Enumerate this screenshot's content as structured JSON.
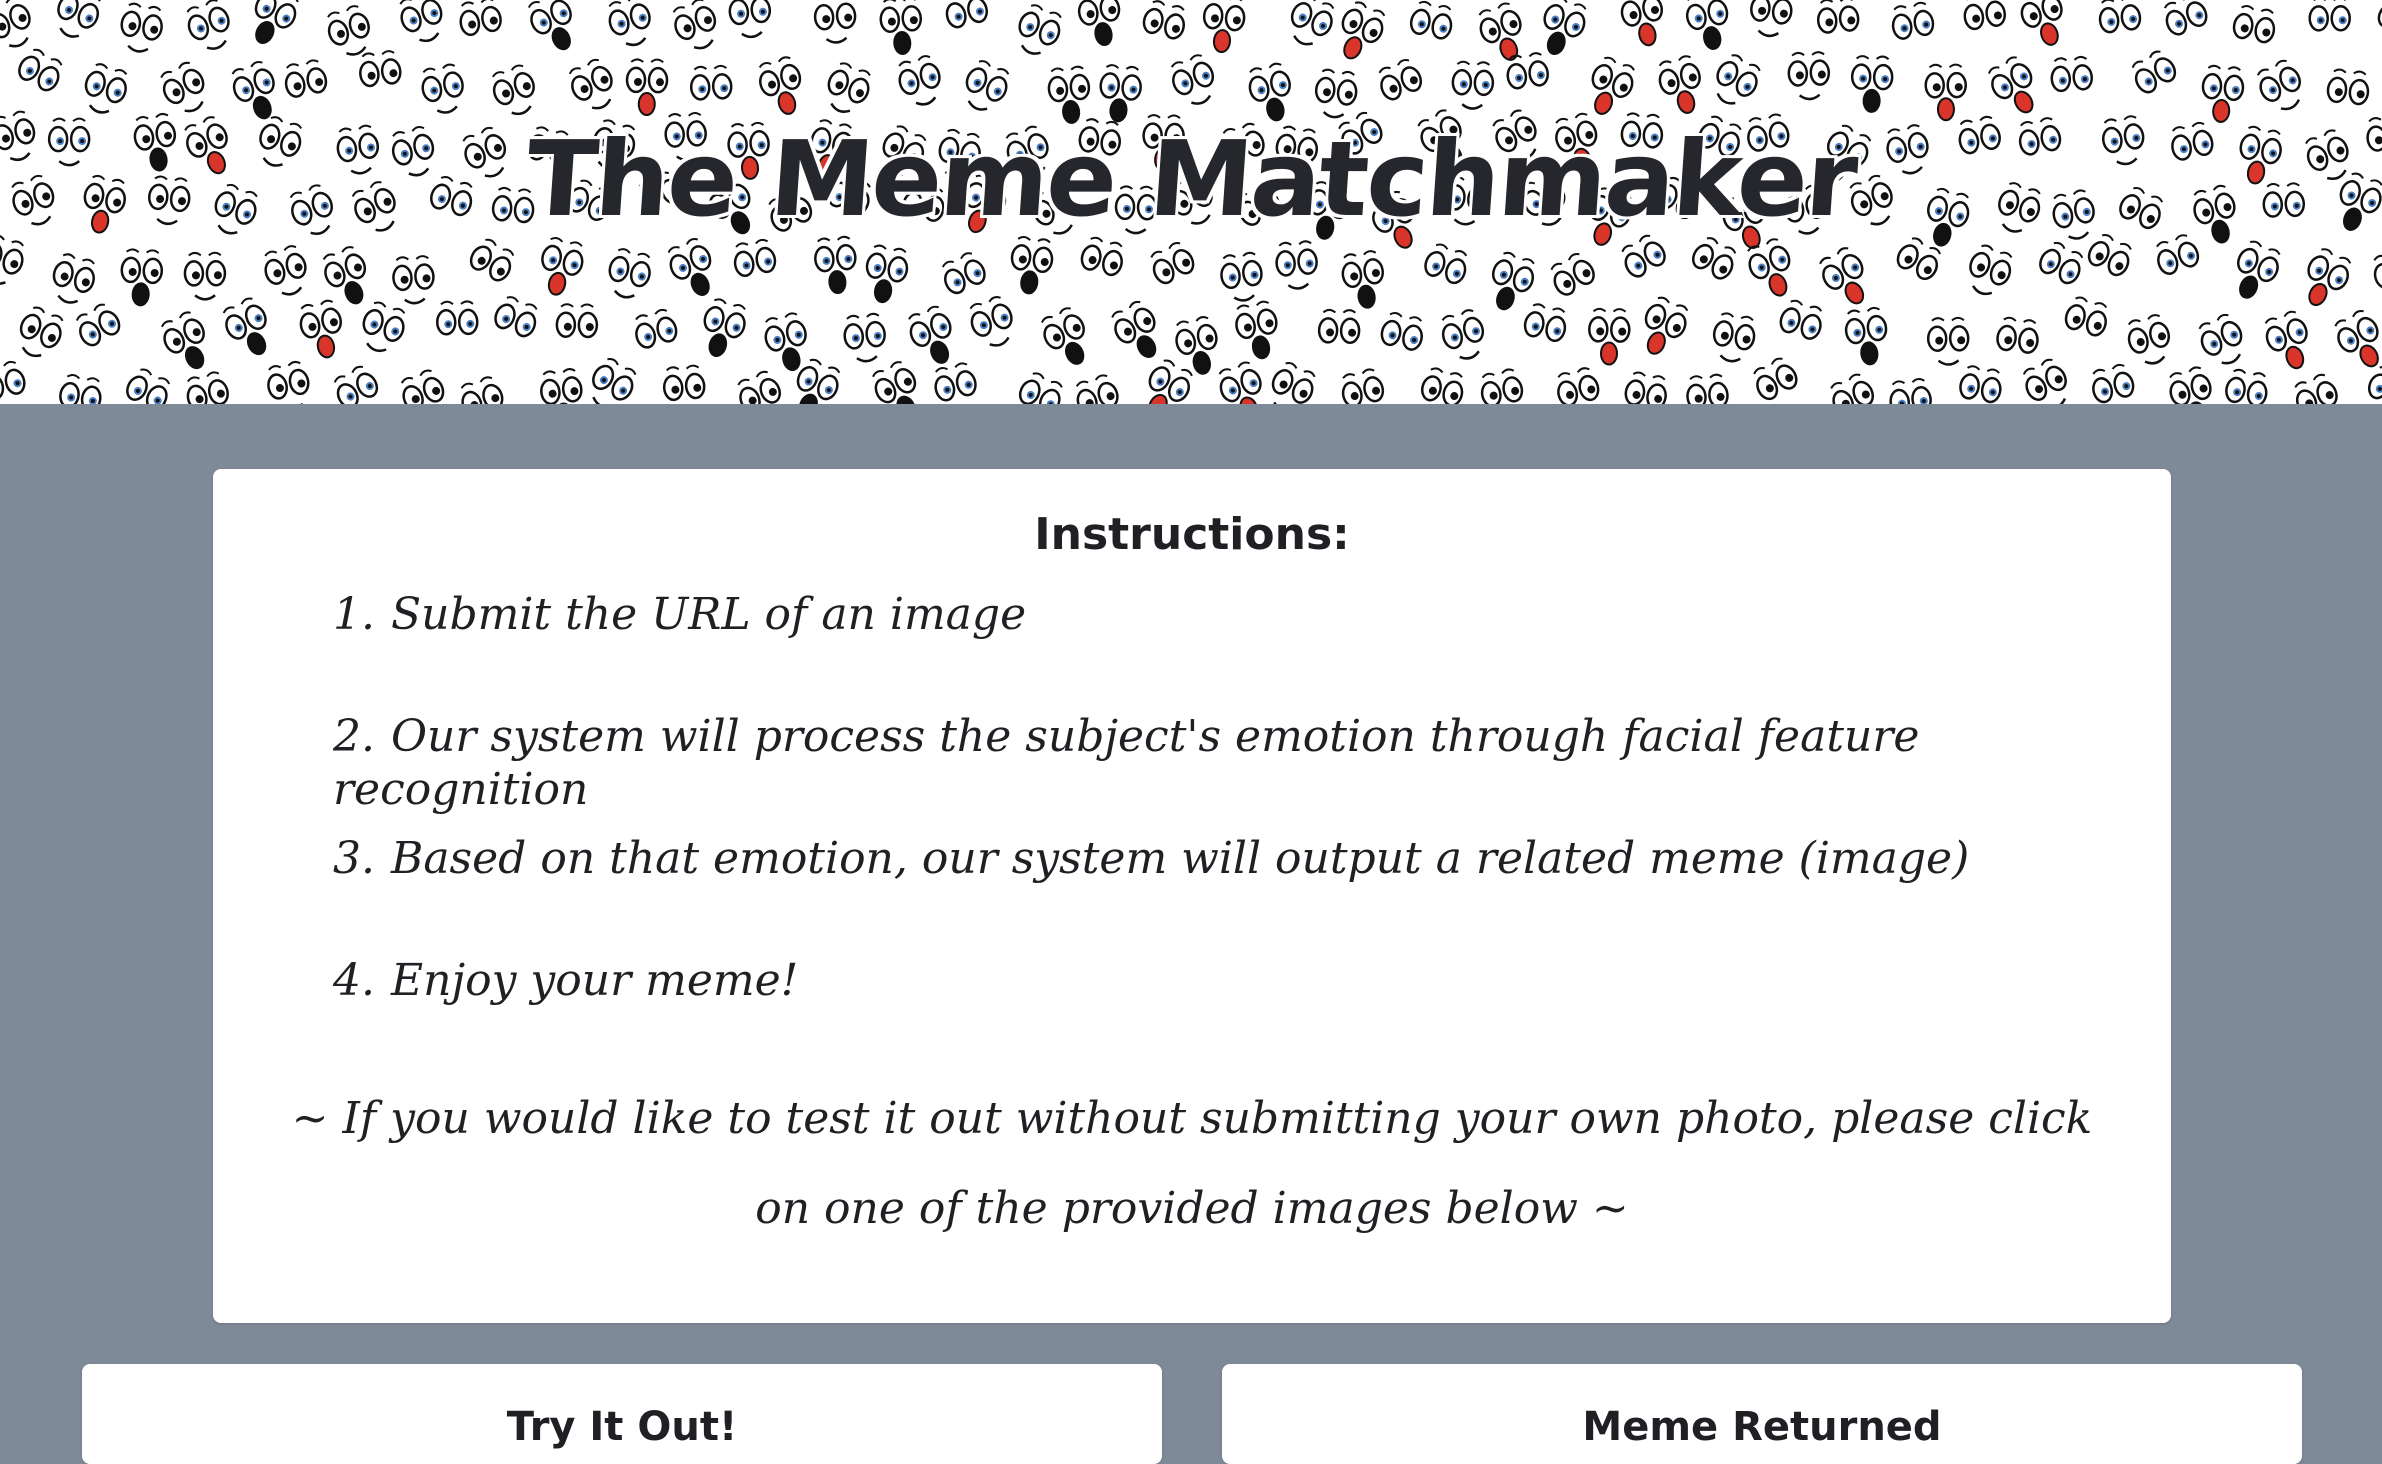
{
  "header": {
    "title": "The Meme Matchmaker"
  },
  "instructions": {
    "heading": "Instructions:",
    "steps": [
      {
        "num": "1.",
        "text": "Submit the URL of an image"
      },
      {
        "num": "2.",
        "text": "Our system will process the subject's emotion through facial feature recognition"
      },
      {
        "num": "3.",
        "text": "Based on that emotion, our system will output a related meme (image)"
      },
      {
        "num": "4.",
        "text": "Enjoy your meme!"
      }
    ],
    "note": "~ If you would like to test it out without submitting your own photo, please click on one of the provided images below ~"
  },
  "panels": {
    "try_title": "Try It Out!",
    "meme_title": "Meme Returned"
  },
  "colors": {
    "page_background": "#7f8a99",
    "card_background": "#ffffff",
    "text": "#1f2024"
  }
}
